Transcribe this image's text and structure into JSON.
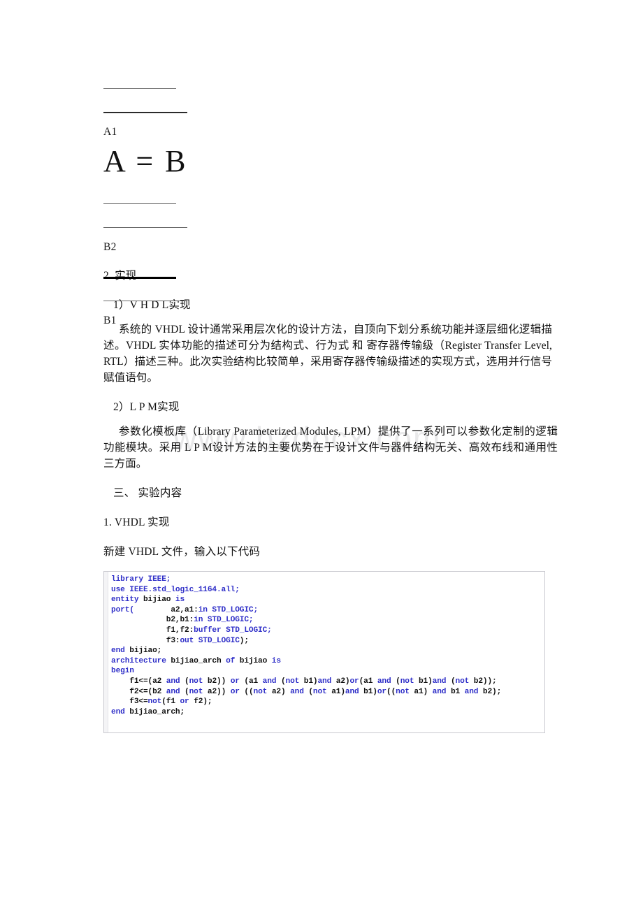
{
  "document": {
    "watermark": "www.bzdocx.com",
    "figure": {
      "labels": [
        {
          "text": "A1"
        },
        {
          "text": "B2"
        },
        {
          "text": "B1"
        }
      ],
      "formula": "A = B"
    },
    "sections": [
      {
        "text": "2. 实现"
      },
      {
        "text": "1）V H D L实现"
      },
      {
        "text": "系统的 VHDL 设计通常采用层次化的设计方法，自顶向下划分系统功能并逐层细化逻辑描述。VHDL 实体功能的描述可分为结构式、行为式 和 寄存器传输级（Register Transfer Level, RTL）描述三种。此次实验结构比较简单，采用寄存器传输级描述的实现方式，选用并行信号赋值语句。"
      },
      {
        "text": "2）L P M实现"
      },
      {
        "text": "参数化模板库（Library Parameterized Modules, LPM）提供了一系列可以参数化定制的逻辑功能模块。采用 L P M设计方法的主要优势在于设计文件与器件结构无关、高效布线和通用性三方面。"
      },
      {
        "text": "三、 实验内容"
      },
      {
        "text": "1. VHDL 实现"
      },
      {
        "text": "新建 VHDL 文件，输入以下代码"
      }
    ],
    "code": {
      "language": "VHDL",
      "lines": [
        [
          {
            "t": "library",
            "c": "kw"
          },
          {
            "t": " IEEE;",
            "c": "kw"
          }
        ],
        [
          {
            "t": "use",
            "c": "kw"
          },
          {
            "t": " IEEE.std_logic_1164.all;",
            "c": "kw"
          }
        ],
        [
          {
            "t": "entity",
            "c": "kw"
          },
          {
            "t": " bijiao ",
            "c": "id"
          },
          {
            "t": "is",
            "c": "kw"
          }
        ],
        [
          {
            "t": "port(",
            "c": "kw"
          },
          {
            "t": "        a2,a1:",
            "c": "id"
          },
          {
            "t": "in STD_LOGIC;",
            "c": "kw"
          }
        ],
        [
          {
            "t": "            b2,b1:",
            "c": "id"
          },
          {
            "t": "in STD_LOGIC;",
            "c": "kw"
          }
        ],
        [
          {
            "t": "            f1,f2:",
            "c": "id"
          },
          {
            "t": "buffer STD_LOGIC;",
            "c": "kw"
          }
        ],
        [
          {
            "t": "            f3:",
            "c": "id"
          },
          {
            "t": "out STD_LOGIC",
            "c": "kw"
          },
          {
            "t": ");",
            "c": "id"
          }
        ],
        [
          {
            "t": "end",
            "c": "kw"
          },
          {
            "t": " bijiao;",
            "c": "id"
          }
        ],
        [
          {
            "t": "architecture",
            "c": "kw"
          },
          {
            "t": " bijiao_arch ",
            "c": "id"
          },
          {
            "t": "of",
            "c": "kw"
          },
          {
            "t": " bijiao ",
            "c": "id"
          },
          {
            "t": "is",
            "c": "kw"
          }
        ],
        [
          {
            "t": "begin",
            "c": "kw"
          }
        ],
        [
          {
            "t": "    f1<=(a2 ",
            "c": "id"
          },
          {
            "t": "and",
            "c": "kw"
          },
          {
            "t": " (",
            "c": "id"
          },
          {
            "t": "not",
            "c": "kw"
          },
          {
            "t": " b2)) ",
            "c": "id"
          },
          {
            "t": "or",
            "c": "kw"
          },
          {
            "t": " (a1 ",
            "c": "id"
          },
          {
            "t": "and",
            "c": "kw"
          },
          {
            "t": " (",
            "c": "id"
          },
          {
            "t": "not",
            "c": "kw"
          },
          {
            "t": " b1)",
            "c": "id"
          },
          {
            "t": "and",
            "c": "kw"
          },
          {
            "t": " a2)",
            "c": "id"
          },
          {
            "t": "or",
            "c": "kw"
          },
          {
            "t": "(a1 ",
            "c": "id"
          },
          {
            "t": "and",
            "c": "kw"
          },
          {
            "t": " (",
            "c": "id"
          },
          {
            "t": "not",
            "c": "kw"
          },
          {
            "t": " b1)",
            "c": "id"
          },
          {
            "t": "and",
            "c": "kw"
          },
          {
            "t": " (",
            "c": "id"
          },
          {
            "t": "not",
            "c": "kw"
          },
          {
            "t": " b2));",
            "c": "id"
          }
        ],
        [
          {
            "t": "    f2<=(b2 ",
            "c": "id"
          },
          {
            "t": "and",
            "c": "kw"
          },
          {
            "t": " (",
            "c": "id"
          },
          {
            "t": "not",
            "c": "kw"
          },
          {
            "t": " a2)) ",
            "c": "id"
          },
          {
            "t": "or",
            "c": "kw"
          },
          {
            "t": " ((",
            "c": "id"
          },
          {
            "t": "not",
            "c": "kw"
          },
          {
            "t": " a2) ",
            "c": "id"
          },
          {
            "t": "and",
            "c": "kw"
          },
          {
            "t": " (",
            "c": "id"
          },
          {
            "t": "not",
            "c": "kw"
          },
          {
            "t": " a1)",
            "c": "id"
          },
          {
            "t": "and",
            "c": "kw"
          },
          {
            "t": " b1)",
            "c": "id"
          },
          {
            "t": "or",
            "c": "kw"
          },
          {
            "t": "((",
            "c": "id"
          },
          {
            "t": "not",
            "c": "kw"
          },
          {
            "t": " a1) ",
            "c": "id"
          },
          {
            "t": "and",
            "c": "kw"
          },
          {
            "t": " b1 ",
            "c": "id"
          },
          {
            "t": "and",
            "c": "kw"
          },
          {
            "t": " b2);",
            "c": "id"
          }
        ],
        [
          {
            "t": "    f3<=",
            "c": "id"
          },
          {
            "t": "not",
            "c": "kw"
          },
          {
            "t": "(f1 ",
            "c": "id"
          },
          {
            "t": "or",
            "c": "kw"
          },
          {
            "t": " f2);",
            "c": "id"
          }
        ],
        [
          {
            "t": "end",
            "c": "kw"
          },
          {
            "t": " bijiao_arch;",
            "c": "id"
          }
        ]
      ]
    }
  },
  "colors": {
    "keyword": "#2f2fc8",
    "text": "#111111",
    "watermark": "#e9e9ea",
    "code_border": "#c9c9cf"
  }
}
